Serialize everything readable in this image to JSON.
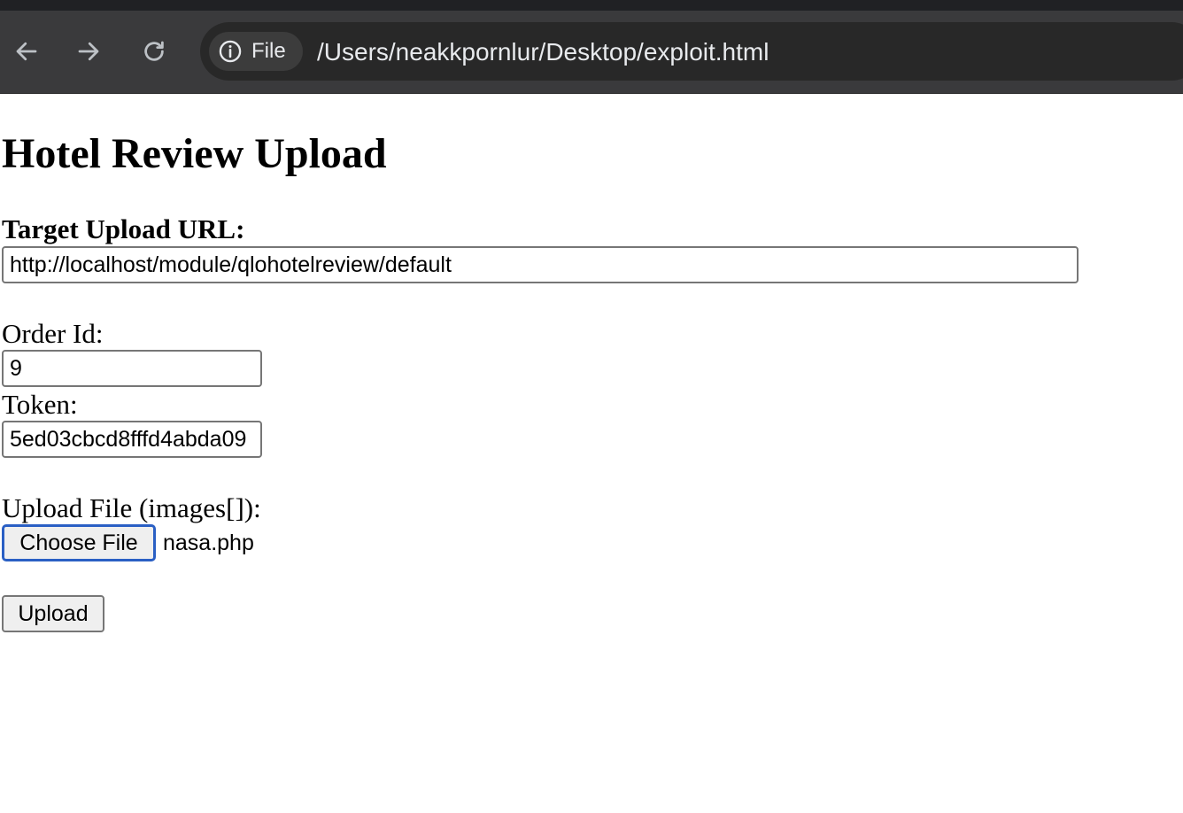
{
  "browser": {
    "site_chip_label": "File",
    "address": "/Users/neakkpornlur/Desktop/exploit.html"
  },
  "page": {
    "title": "Hotel Review Upload",
    "target_url_label": "Target Upload URL:",
    "target_url_value": "http://localhost/module/qlohotelreview/default",
    "order_id_label": "Order Id:",
    "order_id_value": "9",
    "token_label": "Token:",
    "token_value": "5ed03cbcd8fffd4abda09",
    "upload_label": "Upload File (images[]):",
    "choose_file_label": "Choose File",
    "chosen_file_name": "nasa.php",
    "upload_button_label": "Upload"
  }
}
